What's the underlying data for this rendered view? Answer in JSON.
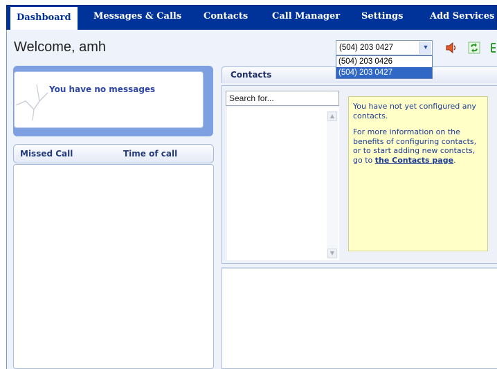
{
  "nav": {
    "tabs": [
      {
        "label": "Dashboard",
        "active": true
      },
      {
        "label": "Messages & Calls",
        "active": false
      },
      {
        "label": "Contacts",
        "active": false
      },
      {
        "label": "Call Manager",
        "active": false
      },
      {
        "label": "Settings",
        "active": false
      },
      {
        "label": "Add Services",
        "active": false
      }
    ]
  },
  "header": {
    "welcome": "Welcome, amh",
    "phone_selected": "(504) 203 0427",
    "phone_options": [
      "(504) 203 0426",
      "(504) 203 0427"
    ],
    "icons": [
      "speaker-icon",
      "refresh-icon",
      "tree-icon"
    ]
  },
  "messages": {
    "empty_text": "You have no messages"
  },
  "missed_calls": {
    "columns": [
      "Missed Call",
      "Time of call"
    ],
    "rows": []
  },
  "contacts": {
    "title": "Contacts",
    "search_placeholder": "Search for...",
    "note_line1": "You have not yet configured any contacts.",
    "note_line2_prefix": "For more information on the benefits of configuring contacts, or to start adding new contacts, go to ",
    "note_link": "the Contacts page",
    "note_line2_suffix": "."
  },
  "colors": {
    "nav_bg": "#003399",
    "accent": "#2e46a6",
    "note_bg": "#ffffc7"
  }
}
